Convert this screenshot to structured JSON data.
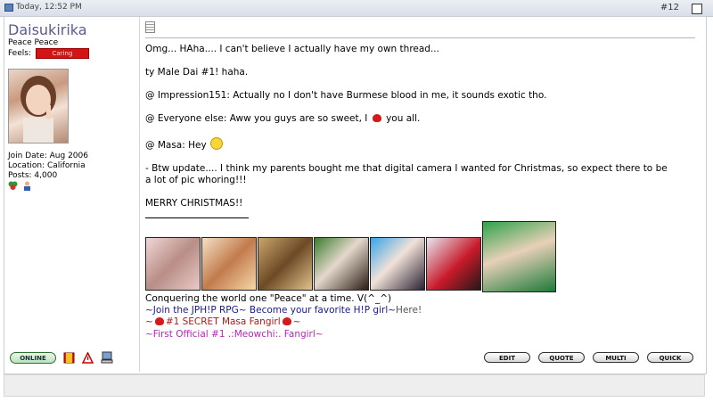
{
  "header": {
    "date": "Today, 12:52 PM",
    "post_number": "#12"
  },
  "user": {
    "name": "Daisukirika",
    "title": "Peace Peace",
    "feels_label": "Feels:",
    "mood": "Caring",
    "join_date": "Join Date: Aug 2006",
    "location": "Location: California",
    "posts": "Posts: 4,000"
  },
  "post": {
    "line1": "Omg... HAha.... I can't believe I actually have my own thread...",
    "line2": "ty Male Dai #1! haha.",
    "line3": "@ Impression151: Actually no I don't have Burmese blood in me, it sounds exotic tho.",
    "line4a": "@ Everyone else: Aww you guys are so sweet, I",
    "line4b": "you all.",
    "line5": "@ Masa: Hey",
    "line6": "- Btw update.... I think my parents bought me that digital camera I wanted for Christmas, so expect there to be",
    "line7": "a lot of pic whoring!!!",
    "line8": "MERRY CHRISTMAS!!"
  },
  "signature": {
    "line1": "Conquering the world one \"Peace\" at a time. V(^_^)",
    "line2a": "~Join the JPH!P RPG~ Become your favorite H!P girl~",
    "line2b": "Here!",
    "line3a": "~",
    "line3b": "#1 SECRET Masa Fangirl",
    "line3c": "~",
    "line4": "~First Official #1 .:Meowchi:. Fangirl~"
  },
  "buttons": {
    "online": "ONLINE",
    "edit": "EDIT",
    "quote": "QUOTE",
    "multi": "MULTI",
    "quick": "QUICK"
  },
  "colors": {
    "username": "#5a5a8c",
    "link_blue": "#1a1a8c",
    "red_text": "#b01818",
    "magenta_text": "#b02bb0",
    "mood_red": "#d41414"
  },
  "icons": [
    "page-icon",
    "doc-icon",
    "heart-icon",
    "smiley-icon",
    "clover-icon",
    "buddy-icon",
    "report-icon",
    "warning-icon",
    "computer-icon"
  ]
}
